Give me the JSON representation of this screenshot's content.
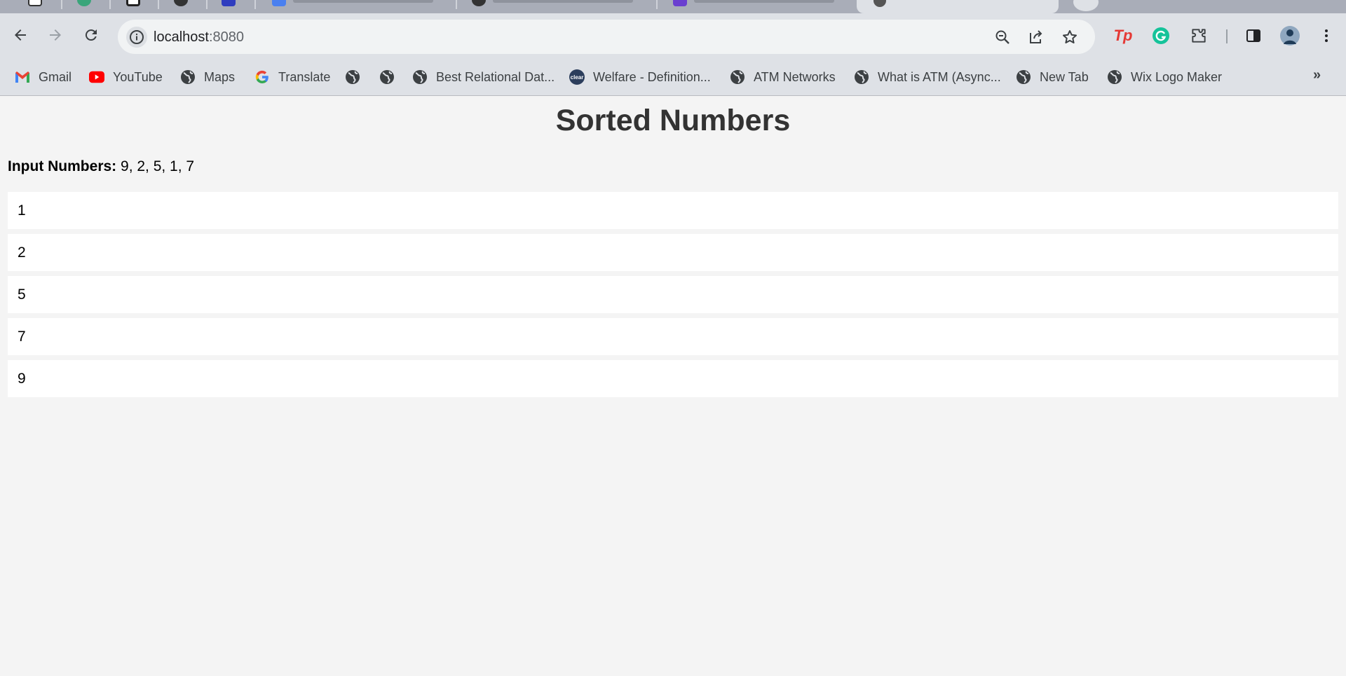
{
  "browser": {
    "address": {
      "host": "localhost",
      "port": ":8080"
    },
    "bookmarks": [
      {
        "label": "Gmail",
        "icon": "gmail-icon"
      },
      {
        "label": "YouTube",
        "icon": "youtube-icon"
      },
      {
        "label": "Maps",
        "icon": "globe-icon"
      },
      {
        "label": "Translate",
        "icon": "google-icon"
      },
      {
        "label": "",
        "icon": "globe-icon"
      },
      {
        "label": "",
        "icon": "globe-icon"
      },
      {
        "label": "Best Relational Dat...",
        "icon": "globe-icon"
      },
      {
        "label": "Welfare - Definition...",
        "icon": "clear-icon"
      },
      {
        "label": "ATM Networks",
        "icon": "globe-icon"
      },
      {
        "label": "What is ATM (Async...",
        "icon": "globe-icon"
      },
      {
        "label": "New Tab",
        "icon": "globe-icon"
      },
      {
        "label": "Wix Logo Maker",
        "icon": "globe-icon"
      }
    ],
    "bookmarks_overflow": "»",
    "clear_badge": "clear",
    "ext_tp_label": "Tp"
  },
  "page": {
    "title": "Sorted Numbers",
    "input_label": "Input Numbers:",
    "input_values": "9, 2, 5, 1, 7",
    "sorted": [
      "1",
      "2",
      "5",
      "7",
      "9"
    ]
  },
  "colors": {
    "chrome_bg": "#dee1e6",
    "page_bg": "#f4f4f4",
    "item_bg": "#ffffff",
    "title_text": "#333333"
  }
}
